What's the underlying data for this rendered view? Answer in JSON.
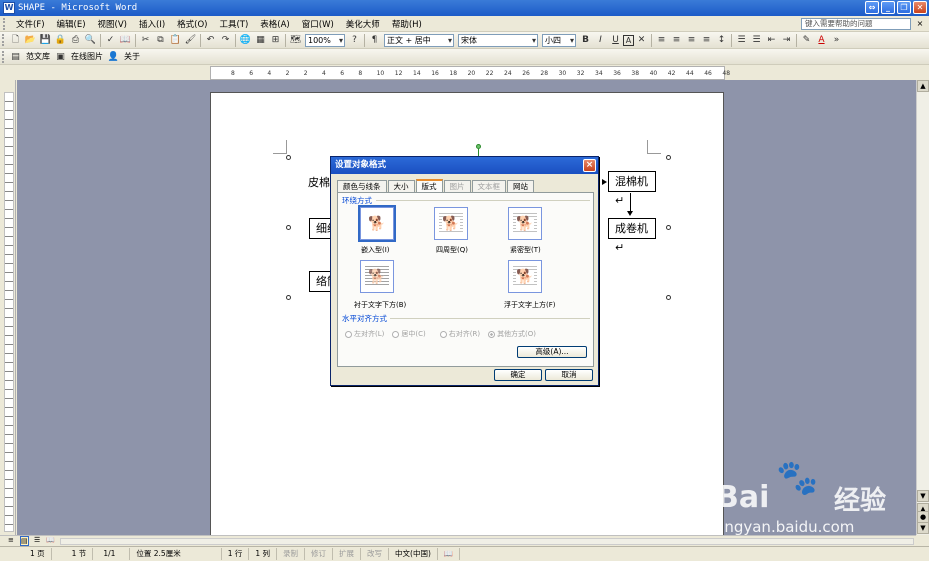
{
  "window": {
    "title": "SHAPE - Microsoft Word",
    "app_icon": "W"
  },
  "menu": {
    "items": [
      "文件(F)",
      "编辑(E)",
      "视图(V)",
      "插入(I)",
      "格式(O)",
      "工具(T)",
      "表格(A)",
      "窗口(W)",
      "美化大师",
      "帮助(H)"
    ],
    "help_placeholder": "键入需要帮助的问题",
    "close": "×"
  },
  "toolbar": {
    "zoom": "100%",
    "style": "正文 + 居中",
    "font": "宋体",
    "size": "小四",
    "bold": "B",
    "italic": "I",
    "underline": "U",
    "char_border": "A",
    "font_color": "A"
  },
  "toolbar2": {
    "item1": "范文库",
    "item2": "在线图片",
    "item3": "关于"
  },
  "ruler": {
    "numbers": [
      "8",
      "6",
      "4",
      "2",
      "2",
      "4",
      "6",
      "8",
      "10",
      "12",
      "14",
      "16",
      "18",
      "20",
      "22",
      "24",
      "26",
      "28",
      "30",
      "32",
      "34",
      "36",
      "38",
      "40",
      "42",
      "44",
      "46",
      "48"
    ]
  },
  "document": {
    "text_left1": "皮棉",
    "box_left2": "细纱",
    "box_left3": "络筒",
    "box_right1": "混棉机↵",
    "box_right2": "成卷机↵"
  },
  "dialog": {
    "title": "设置对象格式",
    "close": "×",
    "tabs": [
      {
        "label": "颜色与线条",
        "state": "normal"
      },
      {
        "label": "大小",
        "state": "normal"
      },
      {
        "label": "版式",
        "state": "active"
      },
      {
        "label": "图片",
        "state": "disabled"
      },
      {
        "label": "文本框",
        "state": "disabled"
      },
      {
        "label": "网站",
        "state": "normal"
      }
    ],
    "wrap_section": "环绕方式",
    "wrap_options": [
      {
        "label": "嵌入型(I)",
        "selected": true
      },
      {
        "label": "四周型(Q)",
        "selected": false
      },
      {
        "label": "紧密型(T)",
        "selected": false
      },
      {
        "label": "衬于文字下方(B)",
        "selected": false
      },
      {
        "label": "浮于文字上方(F)",
        "selected": false
      }
    ],
    "align_section": "水平对齐方式",
    "align_options": [
      {
        "label": "左对齐(L)",
        "checked": false
      },
      {
        "label": "居中(C)",
        "checked": false
      },
      {
        "label": "右对齐(R)",
        "checked": false
      },
      {
        "label": "其他方式(O)",
        "checked": true
      }
    ],
    "advanced": "高级(A)...",
    "ok": "确定",
    "cancel": "取消"
  },
  "statusbar": {
    "page": "1 页",
    "section": "1 节",
    "pages": "1/1",
    "position": "位置 2.5厘米",
    "line": "1 行",
    "column": "1 列",
    "rec": "录制",
    "trk": "修订",
    "ext": "扩展",
    "ovr": "改写",
    "lang": "中文(中国)"
  },
  "watermark": {
    "brand": "Bai",
    "brand2": "经验",
    "url": "jingyan.baidu.com"
  },
  "colors": {
    "title_bar": "#1c5bc8",
    "workspace": "#8e94aa",
    "dialog_title": "#1a4fc1",
    "active_tab_accent": "#e68b2c"
  }
}
